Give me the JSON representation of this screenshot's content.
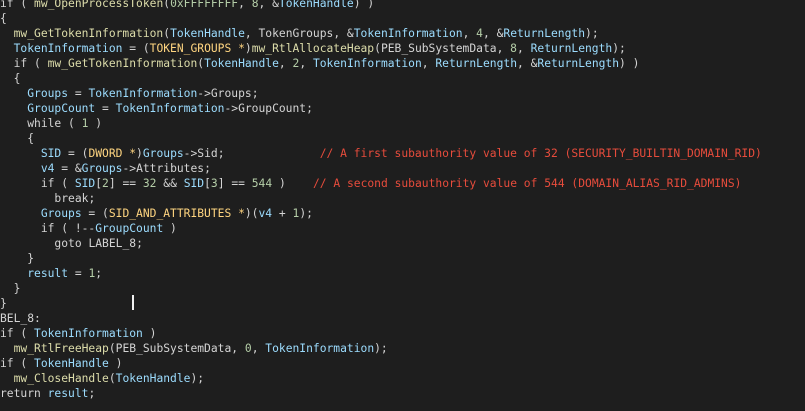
{
  "colors": {
    "background": "#1e1e1e",
    "keyword": "#d4d4d4",
    "function": "#dcdcaa",
    "variable": "#9cdcfe",
    "number": "#b5cea8",
    "type": "#ffd580",
    "comment": "#e74c3c",
    "caret": "#f0f0f0"
  },
  "lines": [
    [
      [
        "kw",
        "if"
      ],
      [
        "op",
        " ( "
      ],
      [
        "fn",
        "mw_OpenProcessToken"
      ],
      [
        "op",
        "("
      ],
      [
        "num",
        "0xFFFFFFFF"
      ],
      [
        "op",
        ", "
      ],
      [
        "num",
        "8"
      ],
      [
        "op",
        ", &"
      ],
      [
        "var",
        "TokenHandle"
      ],
      [
        "op",
        ") )"
      ]
    ],
    [
      [
        "op",
        "{"
      ]
    ],
    [
      [
        "op",
        "  "
      ],
      [
        "fn",
        "mw_GetTokenInformation"
      ],
      [
        "op",
        "("
      ],
      [
        "var",
        "TokenHandle"
      ],
      [
        "op",
        ", "
      ],
      [
        "field",
        "TokenGroups"
      ],
      [
        "op",
        ", &"
      ],
      [
        "var",
        "TokenInformation"
      ],
      [
        "op",
        ", "
      ],
      [
        "num",
        "4"
      ],
      [
        "op",
        ", &"
      ],
      [
        "var",
        "ReturnLength"
      ],
      [
        "op",
        ");"
      ]
    ],
    [
      [
        "op",
        "  "
      ],
      [
        "var",
        "TokenInformation"
      ],
      [
        "op",
        " = ("
      ],
      [
        "type",
        "TOKEN_GROUPS *"
      ],
      [
        "op",
        ")"
      ],
      [
        "fn",
        "mw_RtlAllocateHeap"
      ],
      [
        "op",
        "("
      ],
      [
        "field",
        "PEB_SubSystemData"
      ],
      [
        "op",
        ", "
      ],
      [
        "num",
        "8"
      ],
      [
        "op",
        ", "
      ],
      [
        "var",
        "ReturnLength"
      ],
      [
        "op",
        ");"
      ]
    ],
    [
      [
        "op",
        "  "
      ],
      [
        "kw",
        "if"
      ],
      [
        "op",
        " ( "
      ],
      [
        "fn",
        "mw_GetTokenInformation"
      ],
      [
        "op",
        "("
      ],
      [
        "var",
        "TokenHandle"
      ],
      [
        "op",
        ", "
      ],
      [
        "num",
        "2"
      ],
      [
        "op",
        ", "
      ],
      [
        "var",
        "TokenInformation"
      ],
      [
        "op",
        ", "
      ],
      [
        "var",
        "ReturnLength"
      ],
      [
        "op",
        ", &"
      ],
      [
        "var",
        "ReturnLength"
      ],
      [
        "op",
        ") )"
      ]
    ],
    [
      [
        "op",
        "  {"
      ]
    ],
    [
      [
        "op",
        "    "
      ],
      [
        "var",
        "Groups"
      ],
      [
        "op",
        " = "
      ],
      [
        "var",
        "TokenInformation"
      ],
      [
        "op",
        "->"
      ],
      [
        "field",
        "Groups"
      ],
      [
        "op",
        ";"
      ]
    ],
    [
      [
        "op",
        "    "
      ],
      [
        "var",
        "GroupCount"
      ],
      [
        "op",
        " = "
      ],
      [
        "var",
        "TokenInformation"
      ],
      [
        "op",
        "->"
      ],
      [
        "field",
        "GroupCount"
      ],
      [
        "op",
        ";"
      ]
    ],
    [
      [
        "op",
        "    "
      ],
      [
        "kw",
        "while"
      ],
      [
        "op",
        " ( "
      ],
      [
        "num",
        "1"
      ],
      [
        "op",
        " )"
      ]
    ],
    [
      [
        "op",
        "    {"
      ]
    ],
    [
      [
        "op",
        "      "
      ],
      [
        "var",
        "SID"
      ],
      [
        "op",
        " = ("
      ],
      [
        "type",
        "DWORD *"
      ],
      [
        "op",
        ")"
      ],
      [
        "var",
        "Groups"
      ],
      [
        "op",
        "->"
      ],
      [
        "field",
        "Sid"
      ],
      [
        "op",
        ";              "
      ],
      [
        "cm",
        "// A first subauthority value of 32 (SECURITY_BUILTIN_DOMAIN_RID)"
      ]
    ],
    [
      [
        "op",
        "      "
      ],
      [
        "var",
        "v4"
      ],
      [
        "op",
        " = &"
      ],
      [
        "var",
        "Groups"
      ],
      [
        "op",
        "->"
      ],
      [
        "field",
        "Attributes"
      ],
      [
        "op",
        ";"
      ]
    ],
    [
      [
        "op",
        "      "
      ],
      [
        "kw",
        "if"
      ],
      [
        "op",
        " ( "
      ],
      [
        "var",
        "SID"
      ],
      [
        "op",
        "["
      ],
      [
        "num",
        "2"
      ],
      [
        "op",
        "] == "
      ],
      [
        "num",
        "32"
      ],
      [
        "op",
        " && "
      ],
      [
        "var",
        "SID"
      ],
      [
        "op",
        "["
      ],
      [
        "num",
        "3"
      ],
      [
        "op",
        "] == "
      ],
      [
        "num",
        "544"
      ],
      [
        "op",
        " )    "
      ],
      [
        "cm",
        "// A second subauthority value of 544 (DOMAIN_ALIAS_RID_ADMINS)"
      ]
    ],
    [
      [
        "op",
        "        "
      ],
      [
        "kw",
        "break"
      ],
      [
        "op",
        ";"
      ]
    ],
    [
      [
        "op",
        "      "
      ],
      [
        "var",
        "Groups"
      ],
      [
        "op",
        " = ("
      ],
      [
        "type",
        "SID_AND_ATTRIBUTES *"
      ],
      [
        "op",
        ")("
      ],
      [
        "var",
        "v4"
      ],
      [
        "op",
        " + "
      ],
      [
        "num",
        "1"
      ],
      [
        "op",
        ");"
      ]
    ],
    [
      [
        "op",
        "      "
      ],
      [
        "kw",
        "if"
      ],
      [
        "op",
        " ( !--"
      ],
      [
        "var",
        "GroupCount"
      ],
      [
        "op",
        " )"
      ]
    ],
    [
      [
        "op",
        "        "
      ],
      [
        "kw",
        "goto"
      ],
      [
        "op",
        " "
      ],
      [
        "lbl",
        "LABEL_8"
      ],
      [
        "op",
        ";"
      ]
    ],
    [
      [
        "op",
        "    }"
      ]
    ],
    [
      [
        "op",
        "    "
      ],
      [
        "var",
        "result"
      ],
      [
        "op",
        " = "
      ],
      [
        "num",
        "1"
      ],
      [
        "op",
        ";"
      ]
    ],
    [
      [
        "op",
        "  }"
      ]
    ],
    [
      [
        "op",
        "}"
      ]
    ],
    [
      [
        "lbl",
        "BEL_8"
      ],
      [
        "op",
        ":"
      ]
    ],
    [
      [
        "kw",
        "if"
      ],
      [
        "op",
        " ( "
      ],
      [
        "var",
        "TokenInformation"
      ],
      [
        "op",
        " )"
      ]
    ],
    [
      [
        "op",
        "  "
      ],
      [
        "fn",
        "mw_RtlFreeHeap"
      ],
      [
        "op",
        "("
      ],
      [
        "field",
        "PEB_SubSystemData"
      ],
      [
        "op",
        ", "
      ],
      [
        "num",
        "0"
      ],
      [
        "op",
        ", "
      ],
      [
        "var",
        "TokenInformation"
      ],
      [
        "op",
        ");"
      ]
    ],
    [
      [
        "kw",
        "if"
      ],
      [
        "op",
        " ( "
      ],
      [
        "var",
        "TokenHandle"
      ],
      [
        "op",
        " )"
      ]
    ],
    [
      [
        "op",
        "  "
      ],
      [
        "fn",
        "mw_CloseHandle"
      ],
      [
        "op",
        "("
      ],
      [
        "var",
        "TokenHandle"
      ],
      [
        "op",
        ");"
      ]
    ],
    [
      [
        "kw",
        "return"
      ],
      [
        "op",
        " "
      ],
      [
        "var",
        "result"
      ],
      [
        "op",
        ";"
      ]
    ]
  ]
}
